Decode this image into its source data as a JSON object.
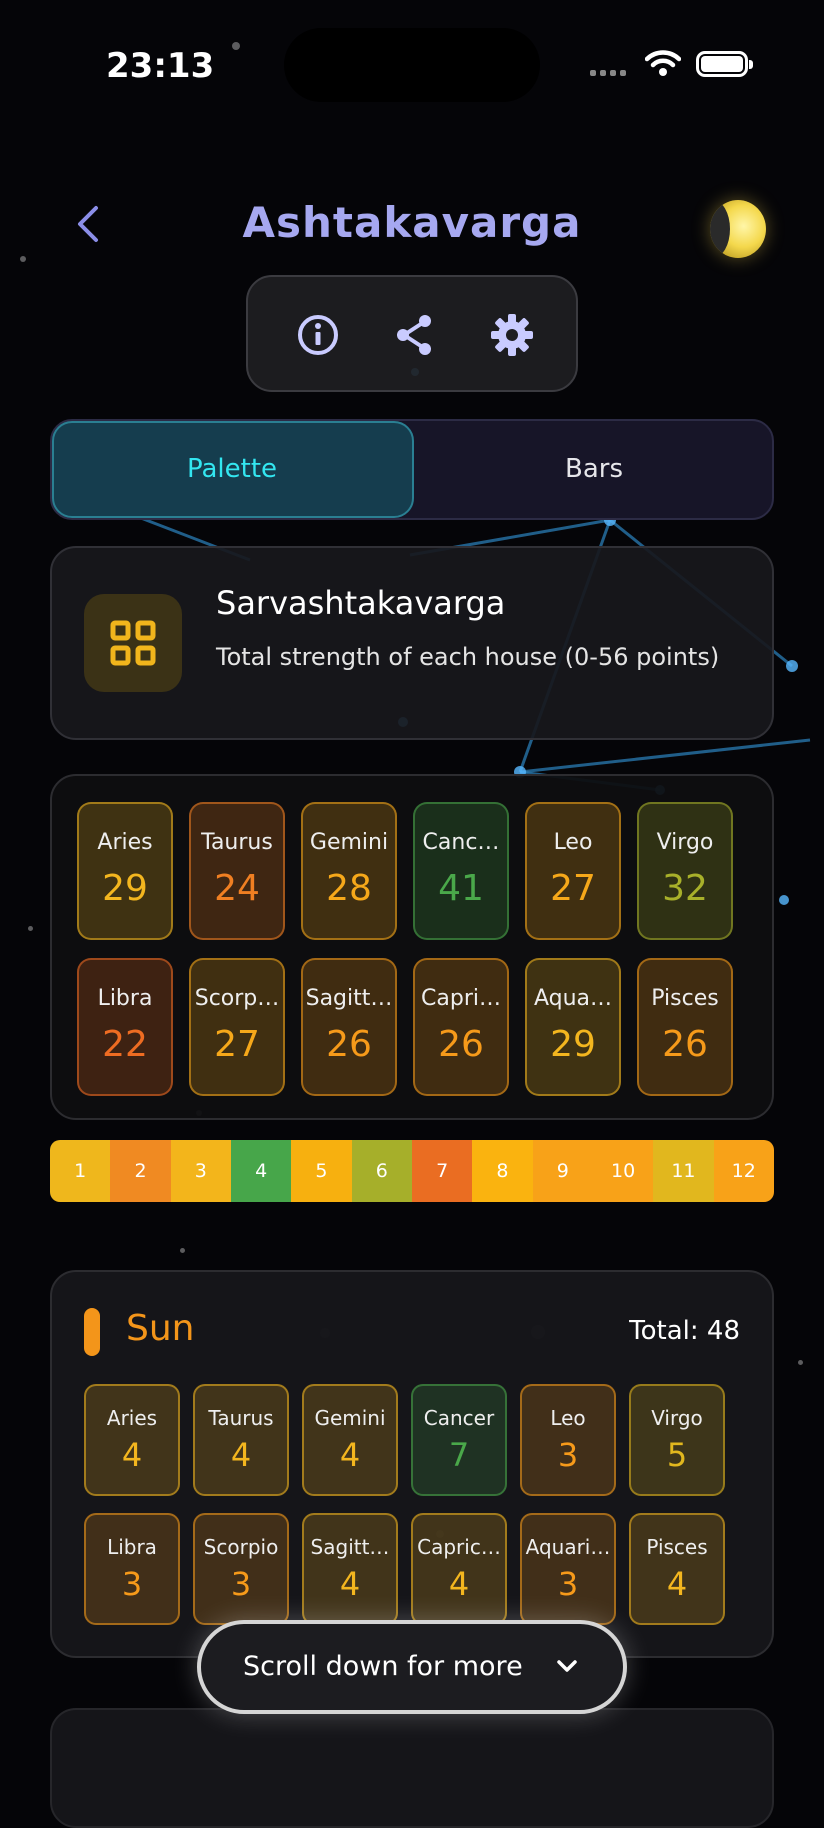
{
  "status_bar": {
    "time": "23:13"
  },
  "header": {
    "title": "Ashtakavarga"
  },
  "toolbar": {
    "icons": [
      "info-icon",
      "share-icon",
      "settings-icon"
    ]
  },
  "tabs": {
    "items": [
      {
        "label": "Palette",
        "selected": true
      },
      {
        "label": "Bars",
        "selected": false
      }
    ]
  },
  "summary": {
    "title": "Sarvashtakavarga",
    "subtitle": "Total strength of each house (0-56 points)",
    "icon": "grid-icon"
  },
  "sarva": {
    "cells": [
      {
        "sign": "Aries",
        "value": "29",
        "color": "#f3b61f"
      },
      {
        "sign": "Taurus",
        "value": "24",
        "color": "#f07f22"
      },
      {
        "sign": "Gemini",
        "value": "28",
        "color": "#f6a81a"
      },
      {
        "sign": "Canc…",
        "value": "41",
        "color": "#4aa84a"
      },
      {
        "sign": "Leo",
        "value": "27",
        "color": "#f6a81a"
      },
      {
        "sign": "Virgo",
        "value": "32",
        "color": "#a8b02a"
      },
      {
        "sign": "Libra",
        "value": "22",
        "color": "#ee6c22"
      },
      {
        "sign": "Scorp…",
        "value": "27",
        "color": "#f6a81a"
      },
      {
        "sign": "Sagitt…",
        "value": "26",
        "color": "#f69a1a"
      },
      {
        "sign": "Capri…",
        "value": "26",
        "color": "#f69a1a"
      },
      {
        "sign": "Aqua…",
        "value": "29",
        "color": "#f3b61f"
      },
      {
        "sign": "Pisces",
        "value": "26",
        "color": "#f69a1a"
      }
    ]
  },
  "strip": {
    "items": [
      {
        "label": "1",
        "color": "#efb71c"
      },
      {
        "label": "2",
        "color": "#f08a22"
      },
      {
        "label": "3",
        "color": "#f3b51b"
      },
      {
        "label": "4",
        "color": "#47a64a"
      },
      {
        "label": "5",
        "color": "#f7b00f"
      },
      {
        "label": "6",
        "color": "#a6af2a"
      },
      {
        "label": "7",
        "color": "#ea6d22"
      },
      {
        "label": "8",
        "color": "#fab30f"
      },
      {
        "label": "9",
        "color": "#f8a218"
      },
      {
        "label": "10",
        "color": "#f8a218"
      },
      {
        "label": "11",
        "color": "#e1b71e"
      },
      {
        "label": "12",
        "color": "#f8a218"
      }
    ]
  },
  "sun": {
    "title": "Sun",
    "total": "Total: 48",
    "cells": [
      {
        "sign": "Aries",
        "value": "4",
        "color": "#f3b61f"
      },
      {
        "sign": "Taurus",
        "value": "4",
        "color": "#f3b61f"
      },
      {
        "sign": "Gemini",
        "value": "4",
        "color": "#f3b61f"
      },
      {
        "sign": "Cancer",
        "value": "7",
        "color": "#4aa84a"
      },
      {
        "sign": "Leo",
        "value": "3",
        "color": "#f69a1a"
      },
      {
        "sign": "Virgo",
        "value": "5",
        "color": "#e1b71e"
      },
      {
        "sign": "Libra",
        "value": "3",
        "color": "#f69a1a"
      },
      {
        "sign": "Scorpio",
        "value": "3",
        "color": "#f69a1a"
      },
      {
        "sign": "Sagitt…",
        "value": "4",
        "color": "#f3b61f"
      },
      {
        "sign": "Capric…",
        "value": "4",
        "color": "#f3b61f"
      },
      {
        "sign": "Aquari…",
        "value": "3",
        "color": "#f69a1a"
      },
      {
        "sign": "Pisces",
        "value": "4",
        "color": "#f3b61f"
      }
    ]
  },
  "scroll_hint": {
    "label": "Scroll down for more"
  }
}
